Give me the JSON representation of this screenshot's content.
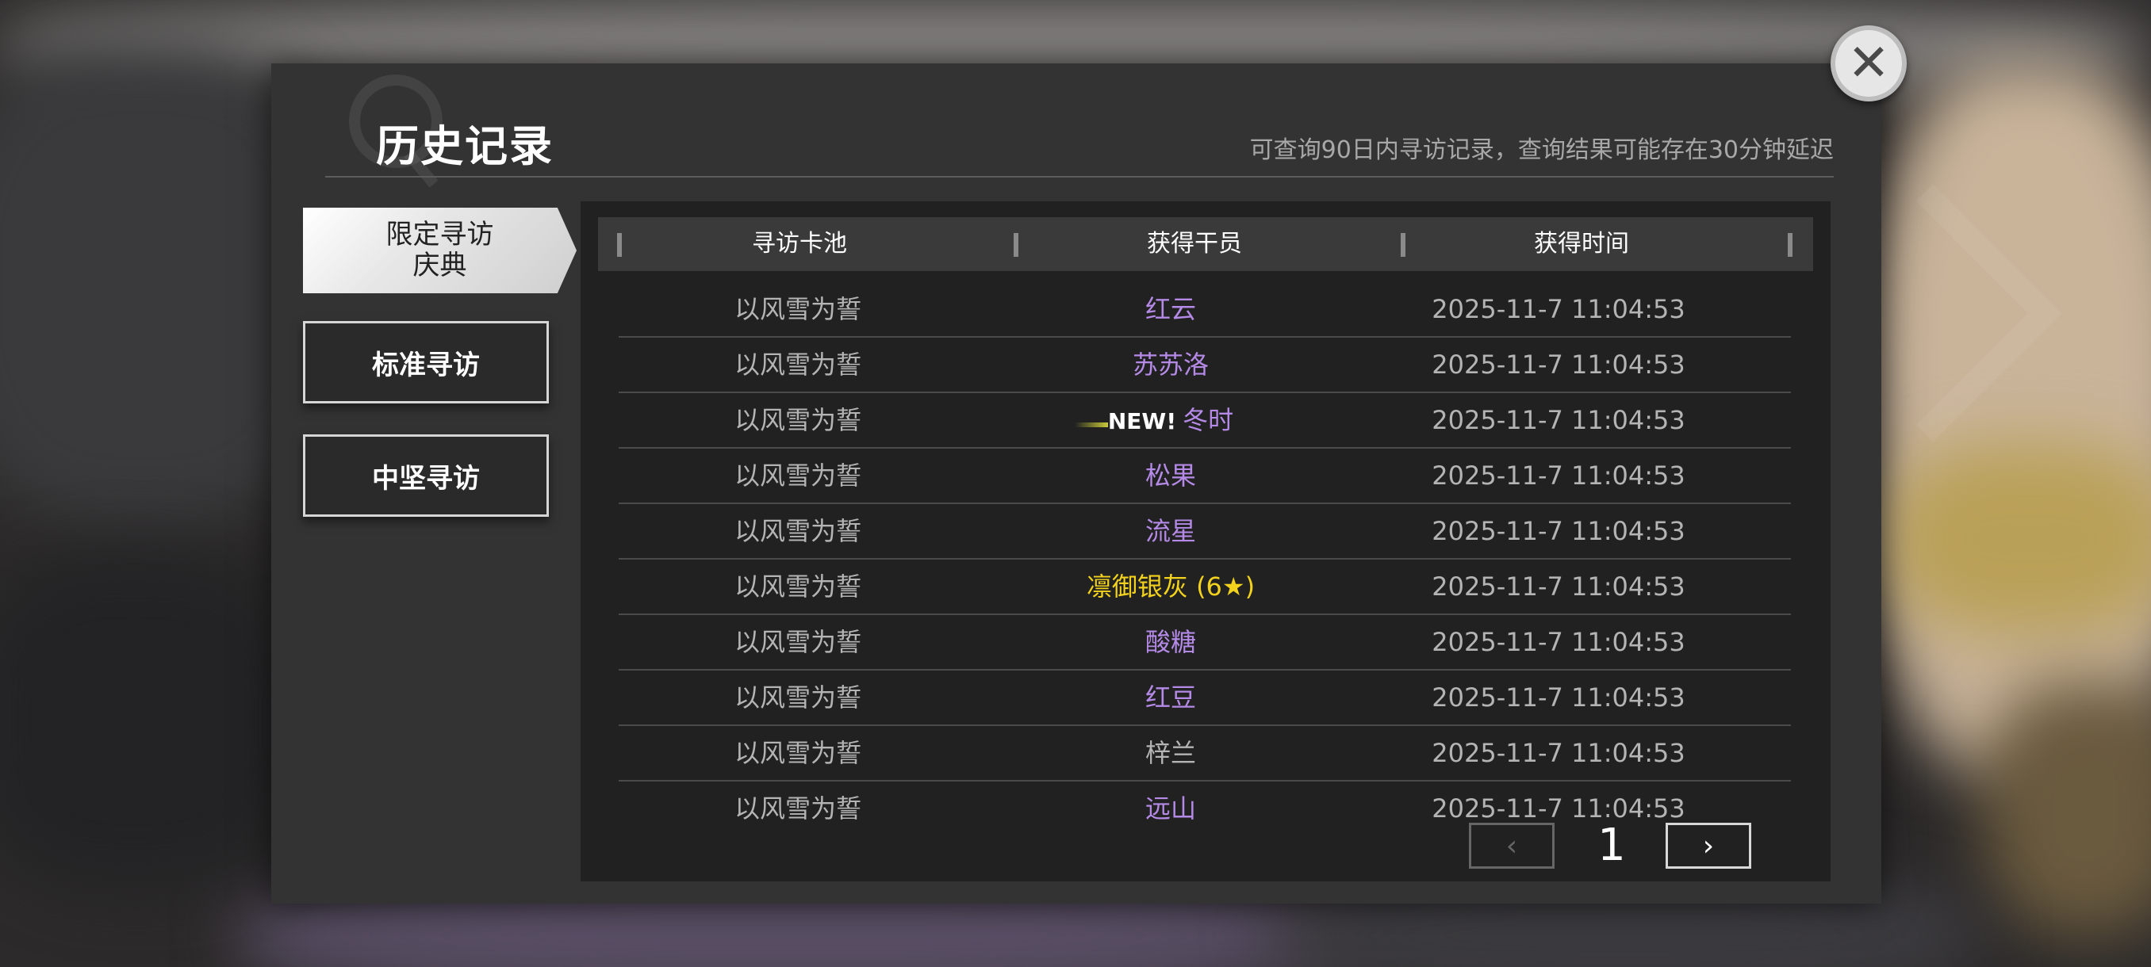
{
  "header": {
    "title": "历史记录",
    "subtitle": "可查询90日内寻访记录，查询结果可能存在30分钟延迟"
  },
  "tabs": [
    {
      "label": "限定寻访\n庆典",
      "line1": "限定寻访",
      "line2": "庆典",
      "active": true
    },
    {
      "label": "标准寻访",
      "active": false
    },
    {
      "label": "中坚寻访",
      "active": false
    }
  ],
  "table": {
    "columns": [
      "寻访卡池",
      "获得干员",
      "获得时间"
    ],
    "rows": [
      {
        "pool": "以风雪为誓",
        "operator": "红云",
        "time": "2025-11-7 11:04:53",
        "rarity": "4"
      },
      {
        "pool": "以风雪为誓",
        "operator": "苏苏洛",
        "time": "2025-11-7 11:04:53",
        "rarity": "4"
      },
      {
        "pool": "以风雪为誓",
        "operator": "冬时",
        "time": "2025-11-7 11:04:53",
        "rarity": "4",
        "tag": "NEW!"
      },
      {
        "pool": "以风雪为誓",
        "operator": "松果",
        "time": "2025-11-7 11:04:53",
        "rarity": "4"
      },
      {
        "pool": "以风雪为誓",
        "operator": "流星",
        "time": "2025-11-7 11:04:53",
        "rarity": "4"
      },
      {
        "pool": "以风雪为誓",
        "operator": "凛御银灰 (6★)",
        "time": "2025-11-7 11:04:53",
        "rarity": "6"
      },
      {
        "pool": "以风雪为誓",
        "operator": "酸糖",
        "time": "2025-11-7 11:04:53",
        "rarity": "4"
      },
      {
        "pool": "以风雪为誓",
        "operator": "红豆",
        "time": "2025-11-7 11:04:53",
        "rarity": "4"
      },
      {
        "pool": "以风雪为誓",
        "operator": "梓兰",
        "time": "2025-11-7 11:04:53",
        "rarity": "3"
      },
      {
        "pool": "以风雪为誓",
        "operator": "远山",
        "time": "2025-11-7 11:04:53",
        "rarity": "4"
      }
    ]
  },
  "pager": {
    "current_page": "1",
    "prev_icon": "chevron-left-icon",
    "next_icon": "chevron-right-icon",
    "prev_glyph": "‹",
    "next_glyph": "›"
  },
  "close": {
    "icon": "close-icon",
    "glyph": "✕"
  },
  "colors": {
    "four_star": "#b48ae6",
    "six_star": "#f2d21d",
    "three_star": "#b4b4b4"
  }
}
